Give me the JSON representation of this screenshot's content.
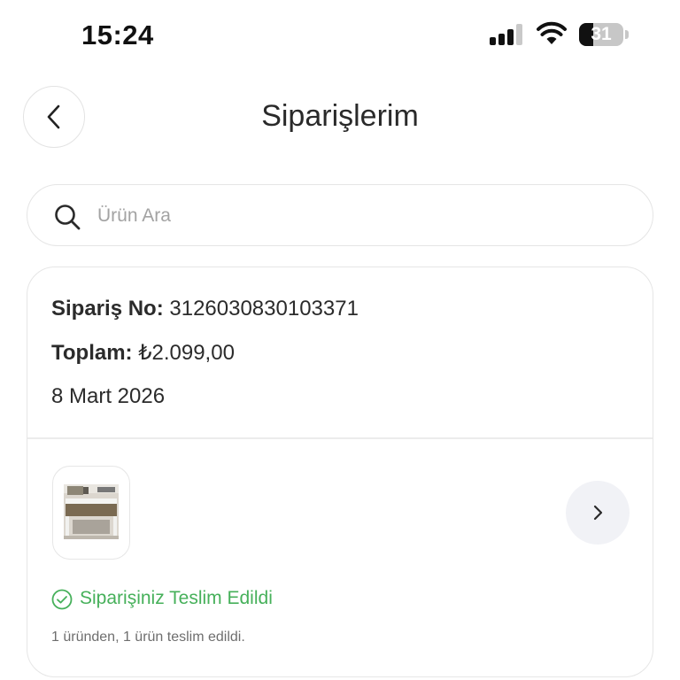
{
  "status_bar": {
    "time": "15:24",
    "battery_level": "31",
    "icons": [
      "cellular-signal-icon",
      "wifi-icon",
      "battery-icon"
    ]
  },
  "header": {
    "title": "Siparişlerim",
    "back_icon": "chevron-left-icon"
  },
  "search": {
    "placeholder": "Ürün Ara",
    "icon": "search-icon"
  },
  "order": {
    "number_label": "Sipariş No:",
    "number_value": "3126030830103371",
    "total_label": "Toplam:",
    "total_value": "₺2.099,00",
    "date": "8 Mart 2026",
    "product_image": "desk-product-thumbnail",
    "detail_icon": "chevron-right-icon",
    "status_icon": "check-circle-icon",
    "status_text": "Siparişiniz Teslim Edildi",
    "status_color": "#46b05a",
    "delivery_note": "1 üründen, 1 ürün teslim edildi."
  }
}
